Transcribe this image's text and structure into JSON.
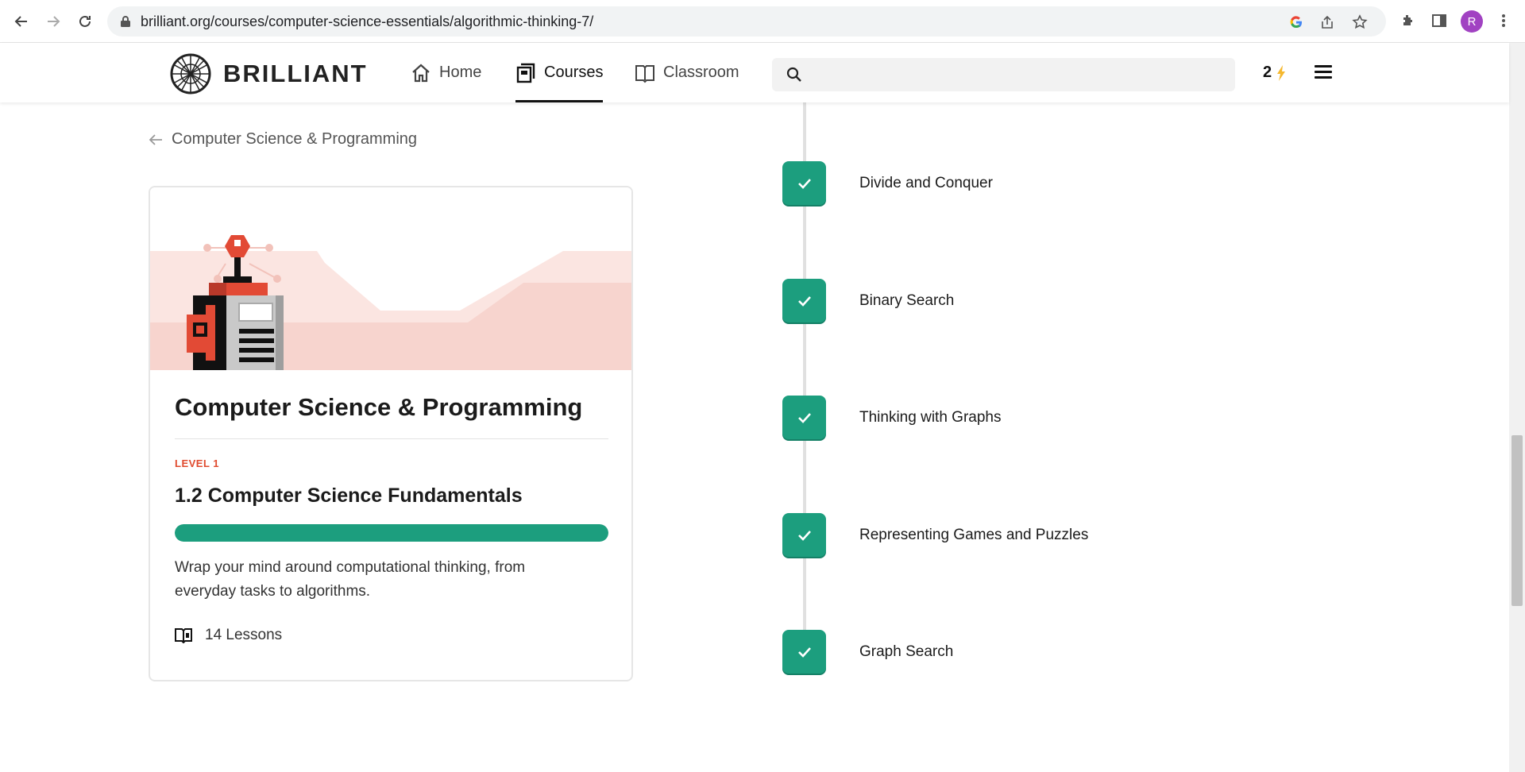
{
  "browser": {
    "url": "brilliant.org/courses/computer-science-essentials/algorithmic-thinking-7/",
    "profile_initial": "R",
    "profile_color": "#a142c2"
  },
  "header": {
    "logo_text": "BRILLIANT",
    "nav": [
      {
        "label": "Home",
        "icon": "home-icon",
        "active": false
      },
      {
        "label": "Courses",
        "icon": "courses-icon",
        "active": true
      },
      {
        "label": "Classroom",
        "icon": "classroom-icon",
        "active": false
      }
    ],
    "search_placeholder": "",
    "streak_count": "2",
    "accent_bolt": "#f5b82e"
  },
  "left": {
    "back_label": "Computer Science & Programming",
    "card": {
      "title": "Computer Science & Programming",
      "level": "LEVEL 1",
      "subtitle": "1.2 Computer Science Fundamentals",
      "progress": 1.0,
      "description": "Wrap your mind around computational thinking, from everyday tasks to algorithms.",
      "lessons": "14 Lessons"
    }
  },
  "timeline": {
    "items": [
      {
        "label": "Divide and Conquer",
        "completed": true
      },
      {
        "label": "Binary Search",
        "completed": true
      },
      {
        "label": "Thinking with Graphs",
        "completed": true
      },
      {
        "label": "Representing Games and Puzzles",
        "completed": true
      },
      {
        "label": "Graph Search",
        "completed": true
      }
    ]
  },
  "colors": {
    "accent_green": "#1c9e7e",
    "level_red": "#e04b2f"
  }
}
